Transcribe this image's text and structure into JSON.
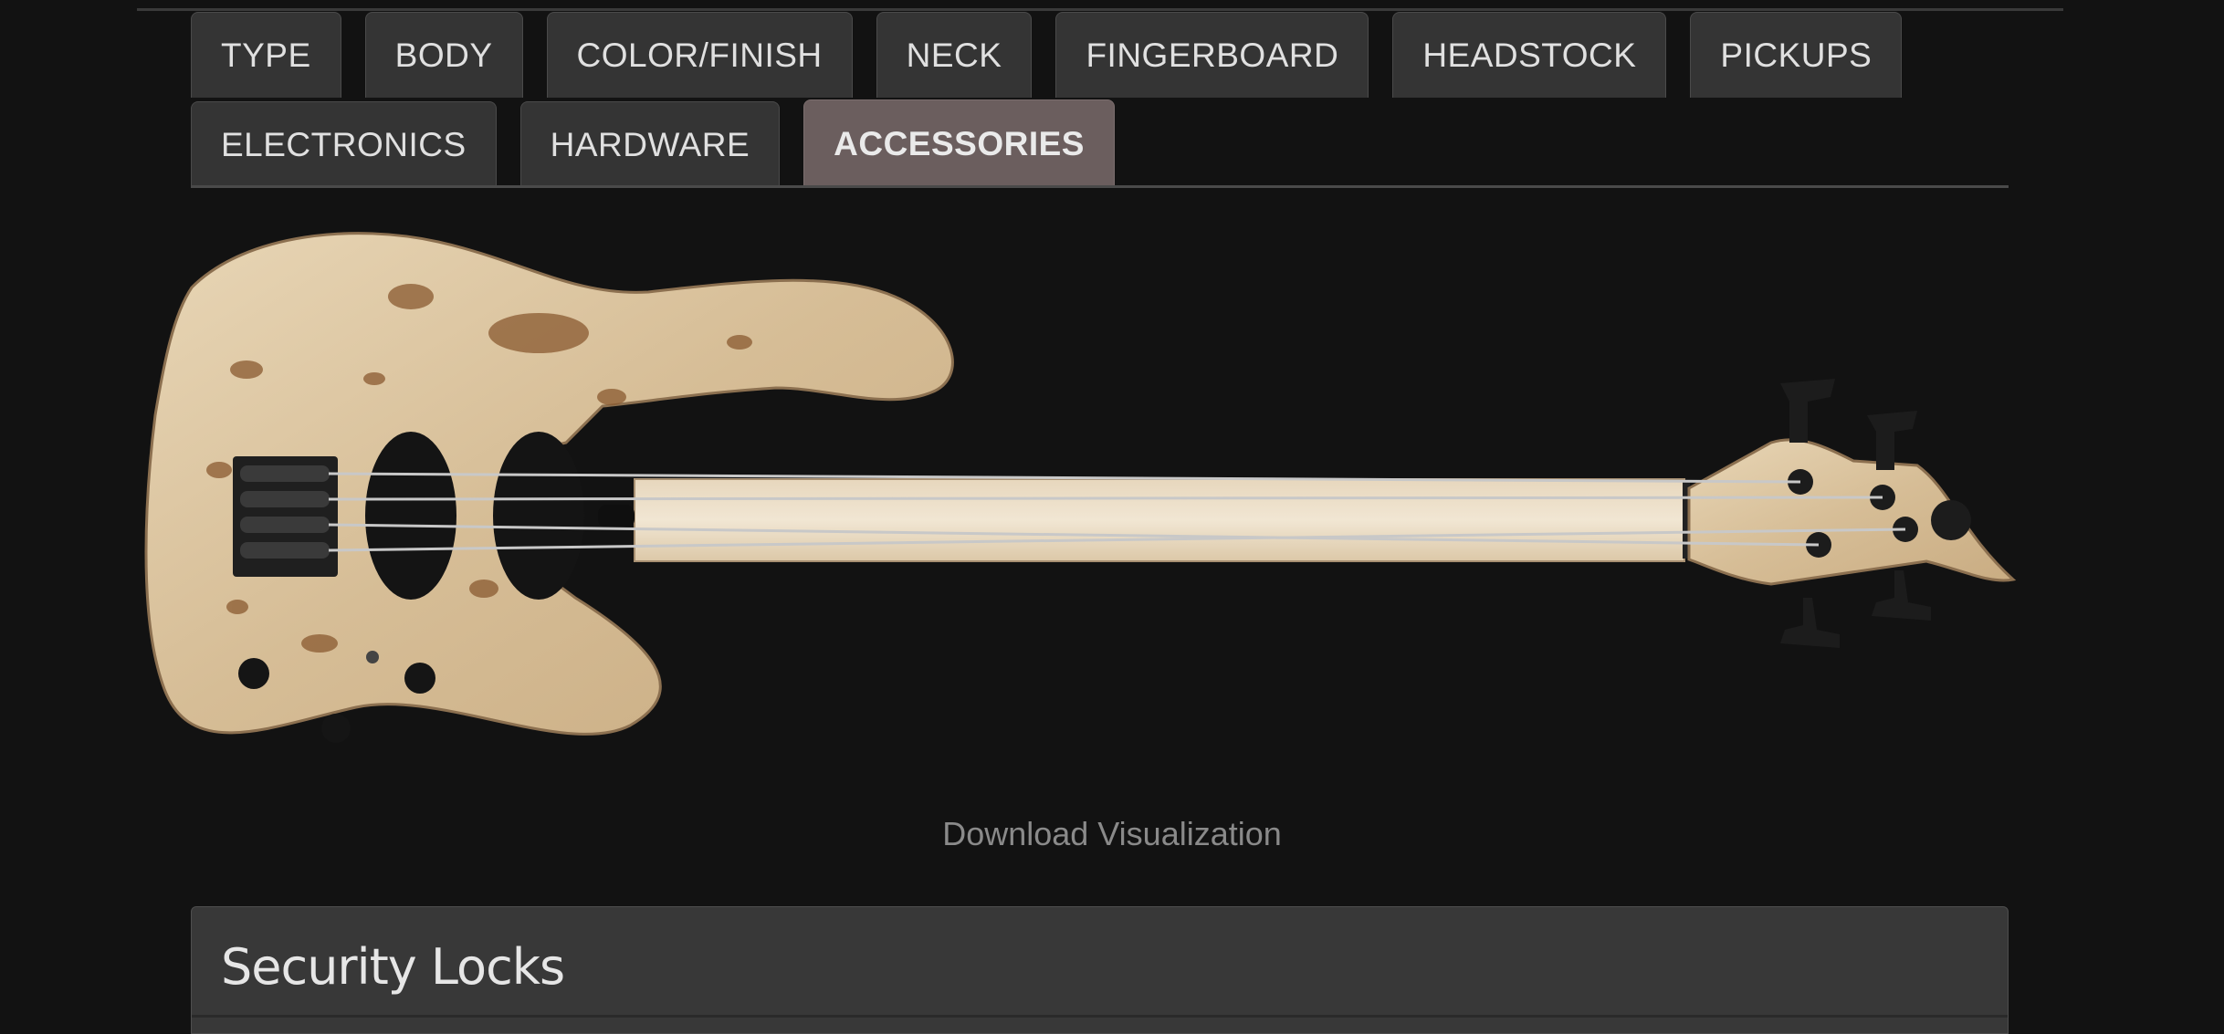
{
  "tabs": {
    "row1": [
      {
        "label": "TYPE"
      },
      {
        "label": "BODY"
      },
      {
        "label": "COLOR/FINISH"
      },
      {
        "label": "NECK"
      },
      {
        "label": "FINGERBOARD"
      },
      {
        "label": "HEADSTOCK"
      },
      {
        "label": "PICKUPS"
      }
    ],
    "row2": [
      {
        "label": "ELECTRONICS"
      },
      {
        "label": "HARDWARE"
      },
      {
        "label": "ACCESSORIES",
        "active": true
      }
    ]
  },
  "visualization": {
    "subject": "bass guitar",
    "finish_colors": {
      "wood_light": "#e6d3b3",
      "wood_mid": "#cfb28a",
      "burl_dark": "#7a4e2a",
      "hardware": "#1a1a1a"
    }
  },
  "download_label": "Download Visualization",
  "panel": {
    "title": "Security Locks"
  },
  "colors": {
    "background": "#121212",
    "tab_bg": "#343434",
    "tab_active_bg": "#6b5e5e",
    "panel_bg": "#383838"
  }
}
